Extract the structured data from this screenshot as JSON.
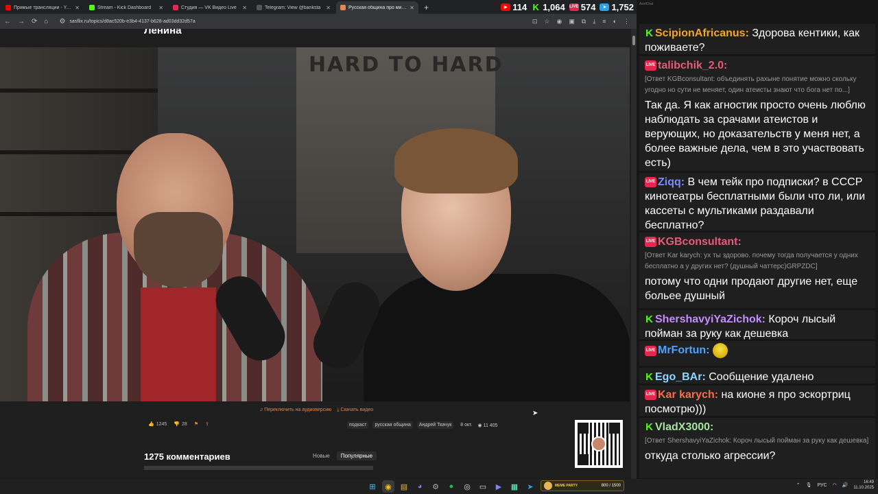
{
  "browser": {
    "tabs": [
      {
        "label": "Прямые трансляции - YouTube",
        "color": "#ff0000",
        "active": false
      },
      {
        "label": "Stream - Kick Dashboard",
        "color": "#53fc18",
        "active": false
      },
      {
        "label": "Студия — VK Видео Live",
        "color": "#e8264e",
        "active": false
      },
      {
        "label": "Telegram: View @banksta",
        "color": "#555555",
        "active": false
      },
      {
        "label": "Русская община про мигр...",
        "color": "#e2874d",
        "active": true
      }
    ],
    "new_tab": "+",
    "url": "sasflix.ru/topics/d8ac520b-e3b4-4137-b628-ad03dd32d57a"
  },
  "stats": [
    {
      "icon": "youtube-icon",
      "value": "114",
      "color": "#ff0000"
    },
    {
      "icon": "kick-icon",
      "value": "1,064",
      "color": "#53fc18"
    },
    {
      "icon": "vk-live-icon",
      "value": "574",
      "color": "#e8264e"
    },
    {
      "icon": "telegram-icon",
      "value": "1,752",
      "color": "#2aa3e0"
    }
  ],
  "page": {
    "title": "Ленина",
    "poster_text": "HARD TO HARD",
    "links": {
      "audio": "Переключить на аудиоверсию",
      "download": "Скачать видео"
    },
    "likes": "1245",
    "dislikes": "28",
    "tags": [
      "подкаст",
      "русская община",
      "Андрей Ткачук"
    ],
    "date": "8 окт.",
    "views": "11 405",
    "comments_title": "1275 комментариев",
    "comment_tabs": [
      "Новые",
      "Популярные"
    ]
  },
  "chat": {
    "app_label": "AxelChat",
    "messages": [
      {
        "platform": "kick",
        "user": "ScipionAfricanus:",
        "user_color": "#f5a623",
        "reply": "",
        "text": "Здорова кентики, как поживаете?"
      },
      {
        "platform": "live",
        "user": "talibchik_2.0:",
        "user_color": "#e75a7c",
        "reply": "[Ответ KGBconsultant: объединять рахыне понятие можно скольку угодно но сути не меняет, один атеисты знают что бога нет по...]",
        "text": "Так да. Я как агностик просто очень люблю наблюдать за срачами атеистов и верующих, но доказательств у меня нет, а более важные дела, чем в это участвовать есть)"
      },
      {
        "platform": "live",
        "user": "Ziqq:",
        "user_color": "#7b8cff",
        "reply": "",
        "text": "В чем тейк про подписки? в СССР кинотеатры бесплатными были что ли, или кассеты с мультиками раздавали бесплатно?"
      },
      {
        "platform": "live",
        "user": "KGBconsultant:",
        "user_color": "#e75a7c",
        "reply": "[Ответ Kar karych: ух ты здорово. почему тогда получается у одних бесплатно а у других нет? (душный чаттерс)GRPZDC]",
        "text": "потому что одни продают другие нет, еще больее душный"
      },
      {
        "platform": "kick",
        "user": "ShershavyiYaZichok:",
        "user_color": "#c58cff",
        "reply": "",
        "text": "Короч лысый пойман за руку как дешевка"
      },
      {
        "platform": "live",
        "user": "MrFortun:",
        "user_color": "#4da3ff",
        "reply": "",
        "text": ""
      },
      {
        "platform": "kick",
        "user": "Ego_BAr:",
        "user_color": "#8fd6ff",
        "reply": "",
        "text": "Сообщение удалено"
      },
      {
        "platform": "live",
        "user": "Kar karych:",
        "user_color": "#ff6b4a",
        "reply": "",
        "text": "на кионе я про эскортриц посмотрю)))"
      },
      {
        "platform": "kick",
        "user": "VladX3000:",
        "user_color": "#a6e3a1",
        "reply": "[Ответ ShershavyiYaZichok: Короч лысый пойман за руку как дешевка]",
        "text": "откуда столько агрессии?"
      }
    ]
  },
  "taskbar": {
    "widget_label": "MEME PARTY",
    "widget_count": "800 / 1500",
    "lang": "РУС",
    "time": "16:49",
    "date": "11.10.2025"
  }
}
